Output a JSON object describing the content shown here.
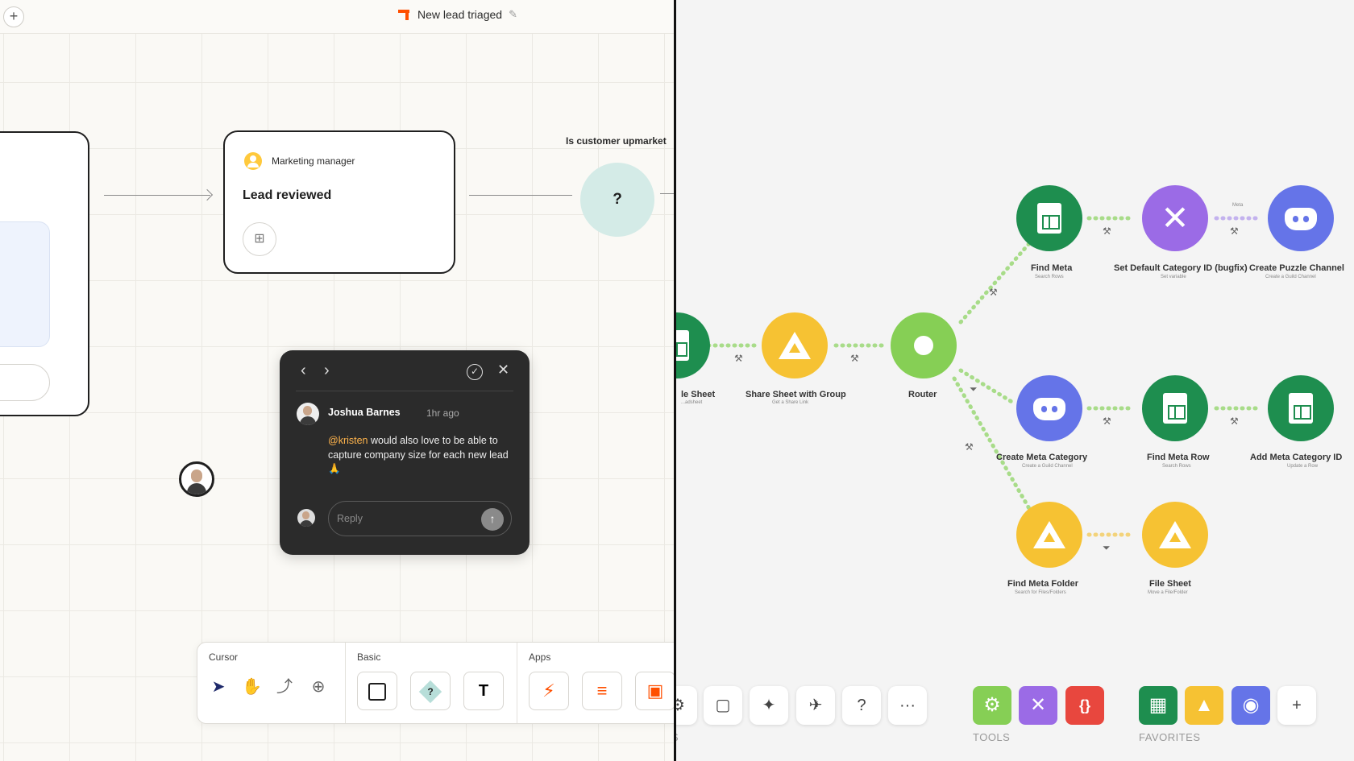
{
  "left": {
    "header": {
      "title": "New lead triaged",
      "add_label": "+"
    },
    "step": {
      "role": "Marketing manager",
      "title": "Lead reviewed"
    },
    "condition": {
      "label": "Is customer upmarket",
      "symbol": "?"
    },
    "comment": {
      "author": "Joshua Barnes",
      "time": "1hr ago",
      "mention": "@kristen",
      "text": " would also love to be able to capture company size for each new lead 🙏",
      "reply_placeholder": "Reply"
    },
    "toolbar": {
      "cursor_label": "Cursor",
      "basic_label": "Basic",
      "apps_label": "Apps",
      "text_tool": "T"
    }
  },
  "right": {
    "nodes": [
      {
        "label": "le Sheet",
        "sub": "...adsheet"
      },
      {
        "label": "Share Sheet with Group",
        "sub": "Get a Share Link"
      },
      {
        "label": "Router",
        "sub": ""
      },
      {
        "label": "Find Meta",
        "sub": "Search Rows"
      },
      {
        "label": "Set Default Category ID (bugfix)",
        "sub": "Set variable"
      },
      {
        "label": "Create Puzzle Channel",
        "sub": "Create a Guild Channel"
      },
      {
        "label": "Create Meta Category",
        "sub": "Create a Guild Channel"
      },
      {
        "label": "Find Meta Row",
        "sub": "Search Rows"
      },
      {
        "label": "Add Meta Category ID",
        "sub": "Update a Row"
      },
      {
        "label": "Find Meta Folder",
        "sub": "Search for Files/Folders"
      },
      {
        "label": "File Sheet",
        "sub": "Move a File/Folder"
      }
    ],
    "meta_tag": "Meta",
    "bottom": {
      "tools_label": "TOOLS",
      "favorites_label": "FAVORITES",
      "more_label": "···",
      "add_label": "+",
      "help_label": "?",
      "cut_label": "S"
    },
    "colors": {
      "sheets": "#1e8e4f",
      "drive": "#f6c233",
      "tools": "#9b6be6",
      "discord": "#6574e8",
      "router": "#86cf55",
      "json": "#e8473e"
    }
  }
}
